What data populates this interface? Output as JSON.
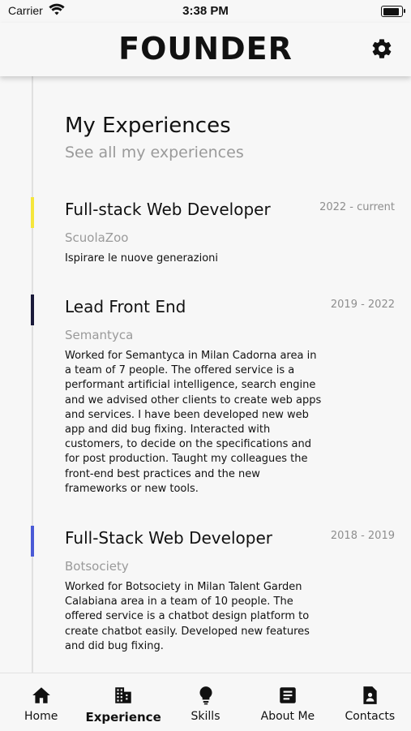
{
  "status_bar": {
    "carrier": "Carrier",
    "time": "3:38 PM",
    "battery_level": 0.95
  },
  "header": {
    "brand": "FOUNDER",
    "settings_icon": "gear-icon"
  },
  "main": {
    "title": "My Experiences",
    "subtitle": "See all my experiences",
    "experiences": [
      {
        "title": "Full-stack Web Developer",
        "period": "2022 - current",
        "company": "ScuolaZoo",
        "description": "Ispirare le nuove generazioni",
        "accent_color": "#f5e63c"
      },
      {
        "title": "Lead Front End",
        "period": "2019 - 2022",
        "company": "Semantyca",
        "description": "Worked for Semantyca in Milan Cadorna area in a team of 7 people. The offered service is a performant artificial intelligence, search engine and we advised other clients to create web apps and services. I have been developed new web app and did bug fixing. Interacted with customers, to decide on the specifications and for post production. Taught my colleagues the front-end best practices and the new frameworks or new tools.",
        "accent_color": "#1a1a3a"
      },
      {
        "title": "Full-Stack Web Developer",
        "period": "2018 - 2019",
        "company": "Botsociety",
        "description": "Worked for Botsociety in Milan Talent Garden Calabiana area in a team of 10 people. The offered service is a chatbot design platform to create chatbot easily. Developed new features and did bug fixing.",
        "accent_color": "#4a5ad6"
      }
    ]
  },
  "tabbar": {
    "active": "Experience",
    "tabs": [
      {
        "label": "Home",
        "icon": "home-icon"
      },
      {
        "label": "Experience",
        "icon": "building-icon"
      },
      {
        "label": "Skills",
        "icon": "lightbulb-icon"
      },
      {
        "label": "About Me",
        "icon": "document-icon"
      },
      {
        "label": "Contacts",
        "icon": "contact-card-icon"
      }
    ]
  }
}
